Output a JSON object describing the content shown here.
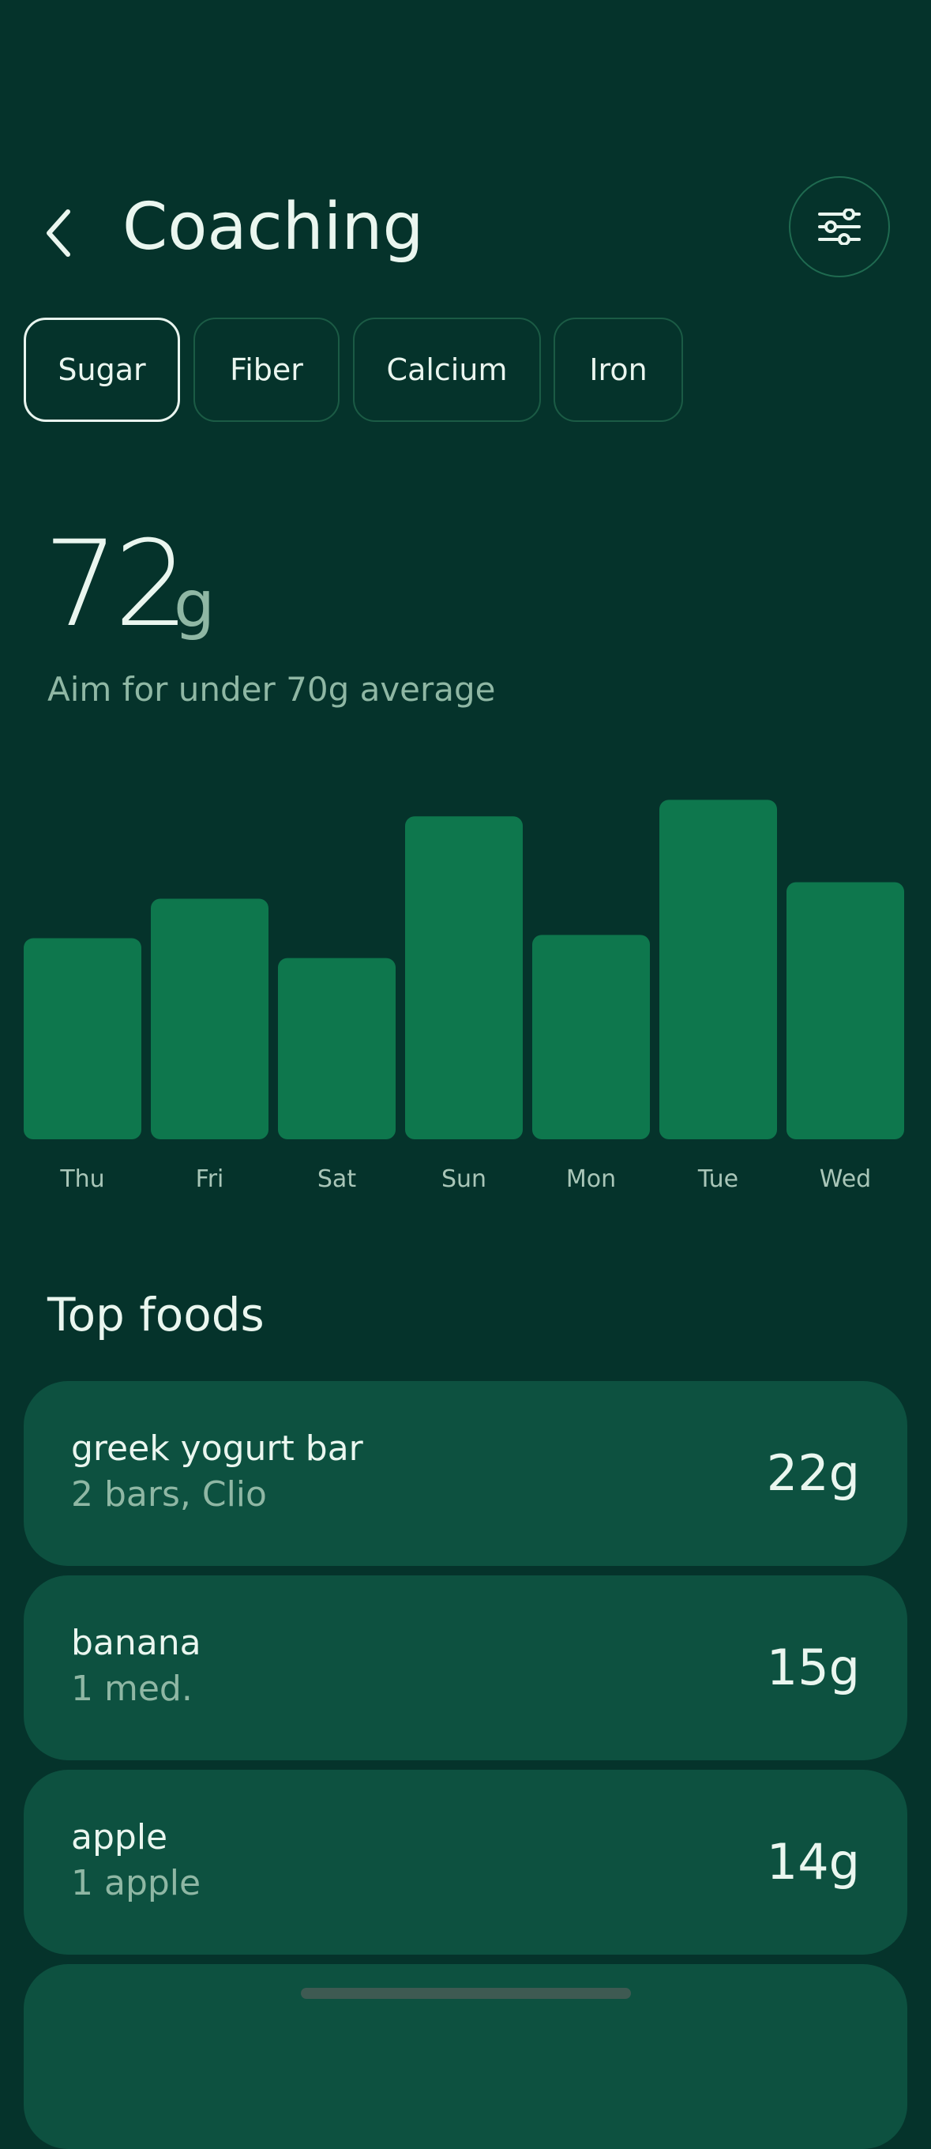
{
  "header": {
    "title": "Coaching",
    "back_icon": "chevron-left-icon",
    "filter_icon": "sliders-icon"
  },
  "tabs": [
    {
      "label": "Sugar",
      "active": true
    },
    {
      "label": "Fiber",
      "active": false
    },
    {
      "label": "Calcium",
      "active": false
    },
    {
      "label": "Iron",
      "active": false
    }
  ],
  "metric": {
    "value": "72",
    "unit": "g",
    "subtitle": "Aim for under 70g average"
  },
  "chart_data": {
    "type": "bar",
    "categories": [
      "Thu",
      "Fri",
      "Sat",
      "Sun",
      "Mon",
      "Tue",
      "Wed"
    ],
    "values": [
      61,
      73,
      55,
      98,
      62,
      103,
      78
    ],
    "ylim": [
      0,
      105
    ],
    "grid": false,
    "bar_color": "#0e774d"
  },
  "top_foods": {
    "title": "Top foods",
    "items": [
      {
        "name": "greek yogurt bar",
        "detail": "2 bars, Clio",
        "amount": "22g"
      },
      {
        "name": "banana",
        "detail": "1 med.",
        "amount": "15g"
      },
      {
        "name": "apple",
        "detail": "1 apple",
        "amount": "14g"
      }
    ]
  },
  "colors": {
    "background": "#05332b",
    "card": "#0d5140",
    "bar": "#0e774d",
    "text_primary": "#eaf6ef",
    "text_secondary": "#8fb7a4"
  }
}
